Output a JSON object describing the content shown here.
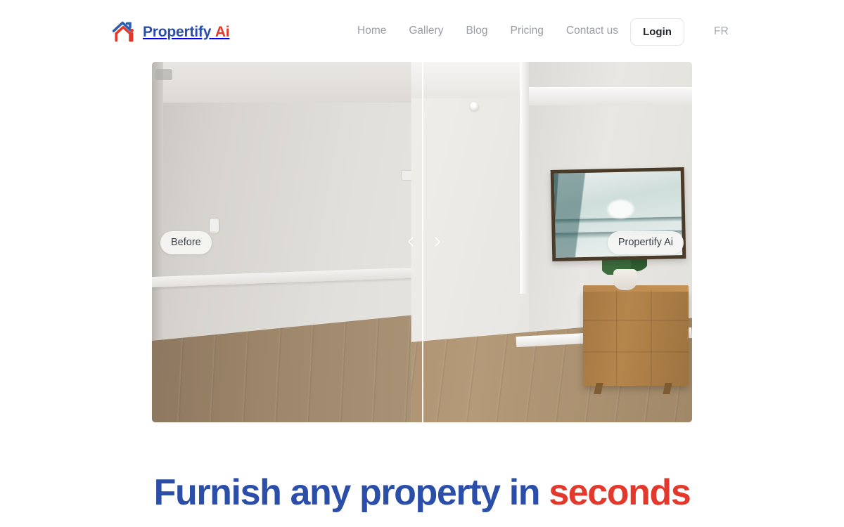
{
  "brand": {
    "name_primary": "Propertify",
    "name_accent": "Ai",
    "logo_icon": "house-logo-icon",
    "color_primary": "#2B4FA8",
    "color_accent": "#E2392C"
  },
  "nav": {
    "items": [
      {
        "label": "Home"
      },
      {
        "label": "Gallery"
      },
      {
        "label": "Blog"
      },
      {
        "label": "Pricing"
      },
      {
        "label": "Contact us"
      }
    ],
    "login_label": "Login",
    "language_label": "FR"
  },
  "compare": {
    "before_label": "Before",
    "after_label": "Propertify Ai",
    "prev_icon": "chevron-left-icon",
    "next_icon": "chevron-right-icon",
    "handle_position_percent": 50
  },
  "hero": {
    "headline_blue": "Furnish any property in",
    "headline_red": "seconds"
  }
}
